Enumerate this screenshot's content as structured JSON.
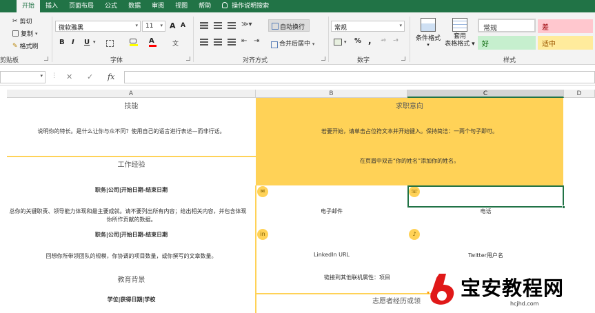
{
  "ribbon_tabs": [
    {
      "label": "开始",
      "active": true
    },
    {
      "label": "插入"
    },
    {
      "label": "页面布局"
    },
    {
      "label": "公式"
    },
    {
      "label": "数据"
    },
    {
      "label": "审阅"
    },
    {
      "label": "视图"
    },
    {
      "label": "帮助"
    },
    {
      "label": "操作说明搜索"
    }
  ],
  "clipboard": {
    "cut": "剪切",
    "copy": "复制",
    "format_painter": "格式刷",
    "group": "剪贴板"
  },
  "font": {
    "name": "微软雅黑",
    "size": "11",
    "grow": "A",
    "shrink": "A",
    "bold": "B",
    "italic": "I",
    "underline": "U",
    "group": "字体",
    "font_color_glyph": "A",
    "phonetic": "文"
  },
  "alignment": {
    "wrap_text": "自动换行",
    "merge_center": "合并后居中",
    "group": "对齐方式"
  },
  "number": {
    "format": "常规",
    "percent": "%",
    "comma": ",",
    "group": "数字"
  },
  "styles": {
    "conditional": "条件格式",
    "format_table": "套用\n表格格式",
    "normal": "常规",
    "bad": "差",
    "good": "好",
    "neutral": "适中",
    "group": "样式",
    "colors": {
      "normal_bg": "#ffffff",
      "bad_bg": "#ffc7ce",
      "bad_fg": "#9c0006",
      "good_bg": "#c6efce",
      "good_fg": "#006100",
      "neutral_bg": "#ffeb9c",
      "neutral_fg": "#9c5700"
    }
  },
  "formula_bar": {
    "cancel": "✕",
    "enter": "✓",
    "fx": "fx",
    "value": ""
  },
  "columns": [
    "A",
    "B",
    "C",
    "D"
  ],
  "sheet": {
    "skills_heading": "技能",
    "skills_text": "说明你的特长。是什么让你与众不同？使用自己的语言进行表述—而非行话。",
    "objective_heading": "求职意向",
    "objective_text_1": "若要开始，请单击占位符文本并开始键入。保持简洁：一两个句子即可。",
    "objective_text_2": "在页眉中双击“你的姓名”添加你的姓名。",
    "experience_heading": "工作经验",
    "job_1_title": "职务|公司|开始日期-结束日期",
    "job_1_text_a": "总你的关键职责、领导能力体现和最主要成就。请不要列出所有内容；给出相关内容，并包含体现",
    "job_1_text_b": "你所作贡献的数据。",
    "job_2_title": "职务|公司|开始日期-结束日期",
    "job_2_text": "回想你所带领团队的规模，你协调的项目数量，或你撰写的文章数量。",
    "education_heading": "教育背景",
    "education_item": "学位|获得日期|学校",
    "email_label": "电子邮件",
    "phone_label": "电话",
    "linkedin_label": "LinkedIn URL",
    "twitter_label": "Twitter用户名",
    "other_links": "链接到其他联机属性：项目",
    "volunteer_heading": "志愿者经历或领"
  },
  "watermark": {
    "title": "宝安教程网",
    "url": "hcjhd.com"
  }
}
